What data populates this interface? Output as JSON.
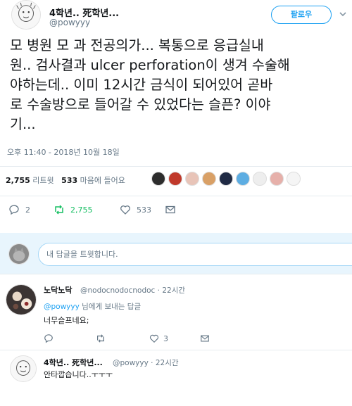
{
  "tweet": {
    "author_name": "4학년.. 死학년...",
    "author_handle": "@powyyy",
    "follow_label": "팔로우",
    "text": "모 병원 모 과 전공의가... 복통으로 응급실내\n원.. 검사결과 ulcer perforation이 생겨 수술해\n야하는데.. 이미 12시간 금식이 되어있어 곧바\n로 수술방으로 들어갈 수 있었다는 슬픈? 이야\n기...",
    "timestamp": "오후 11:40 - 2018년 10월 18일",
    "retweet_count": "2,755",
    "retweet_label": "리트윗",
    "like_count": "533",
    "like_label": "마음에 들어요",
    "reply_action_count": "2",
    "retweet_action_count": "2,755",
    "like_action_count": "533"
  },
  "reply_box": {
    "placeholder": "내 답글을 트윗합니다."
  },
  "replies": [
    {
      "name": "노닥노닥",
      "meta": "@nodocnodocnodoc · 22시간",
      "reply_to_handle": "@powyyy",
      "reply_to_suffix": "님에게 보내는 답글",
      "text": "너무슬프네요;",
      "like_count": "3"
    },
    {
      "name": "4학년.. 死학년...",
      "meta": "@powyyy · 22시간",
      "text": "안타깝습니다..ㅜㅜㅜ"
    }
  ],
  "colors": {
    "accent": "#1da1f2",
    "retweet_green": "#17bf63",
    "muted": "#657786"
  },
  "icons": [
    "chevron-down-icon",
    "reply-icon",
    "retweet-icon",
    "heart-icon",
    "message-icon"
  ]
}
